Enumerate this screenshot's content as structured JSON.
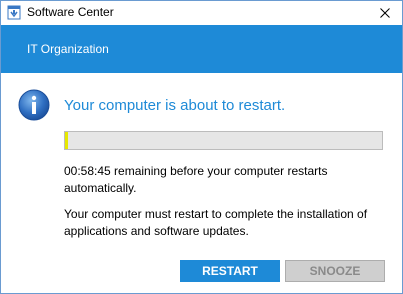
{
  "window": {
    "title": "Software Center",
    "close_icon": "close-icon",
    "app_icon": "software-center-icon"
  },
  "banner": {
    "organization": "IT Organization",
    "color": "#1e8ad7"
  },
  "dialog": {
    "icon": "info-icon",
    "headline": "Your computer is about to restart.",
    "progress": {
      "fraction": 0.005,
      "fill_color": "#e6e800"
    },
    "countdown_message": "00:58:45 remaining before your computer restarts automatically.",
    "reason_message": "Your computer must restart to complete the installation of applications and software updates."
  },
  "buttons": {
    "restart_label": "RESTART",
    "snooze_label": "SNOOZE"
  },
  "colors": {
    "accent": "#1e8ad7",
    "disabled_button": "#cfcfcf"
  }
}
